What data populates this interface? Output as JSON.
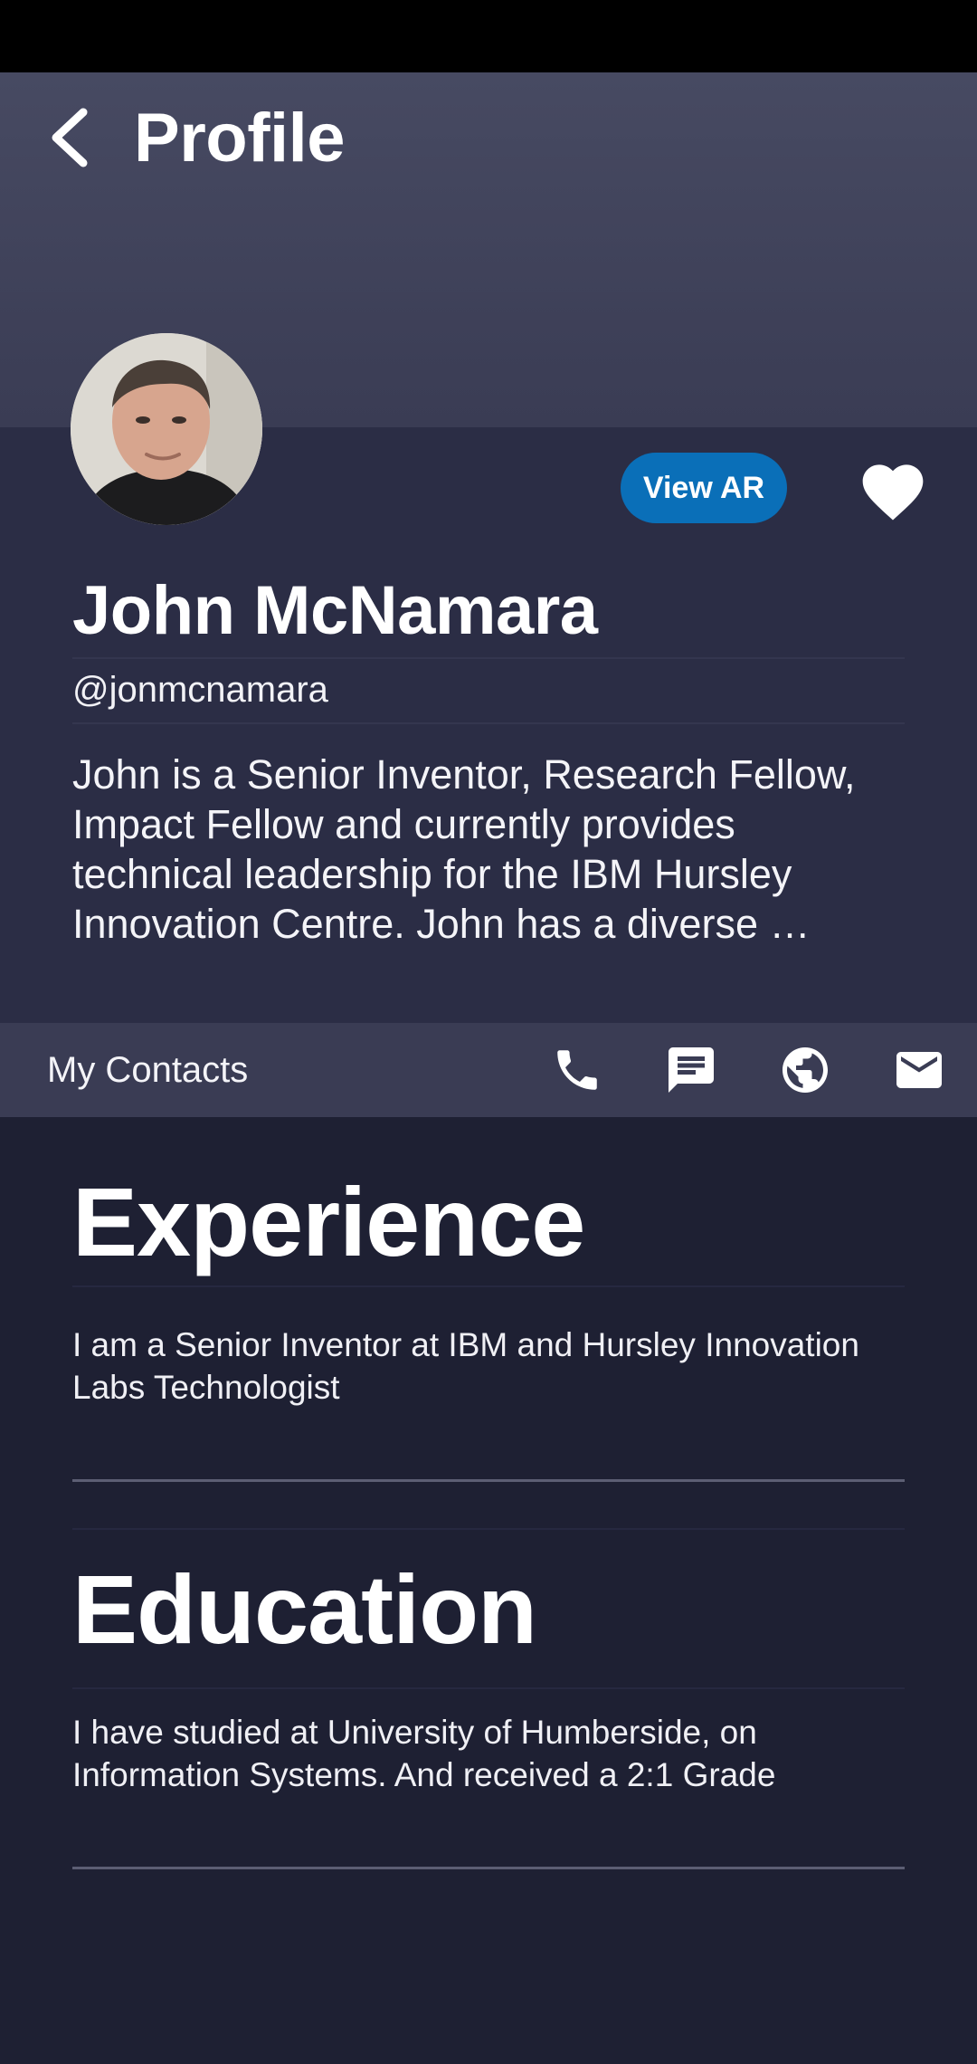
{
  "header": {
    "title": "Profile",
    "back_icon": "chevron-left-icon",
    "background_color": "#474a62"
  },
  "profile": {
    "name": "John McNamara",
    "handle": "@jonmcnamara",
    "bio": "John is a Senior Inventor, Research Fellow, Impact Fellow and currently provides technical leadership for the IBM Hursley Innovation Centre. John has a diverse …",
    "view_ar_label": "View AR",
    "favorite_icon": "heart-icon",
    "accent_color": "#0a6fb8"
  },
  "contacts": {
    "label": "My Contacts",
    "icons": [
      "phone-icon",
      "message-icon",
      "globe-icon",
      "mail-icon"
    ]
  },
  "sections": {
    "experience": {
      "title": "Experience",
      "text": "I am a Senior Inventor at IBM and Hursley Innovation Labs Technologist"
    },
    "education": {
      "title": "Education",
      "text": "I have studied at University of Humberside, on Information Systems. And received a 2:1 Grade"
    }
  }
}
